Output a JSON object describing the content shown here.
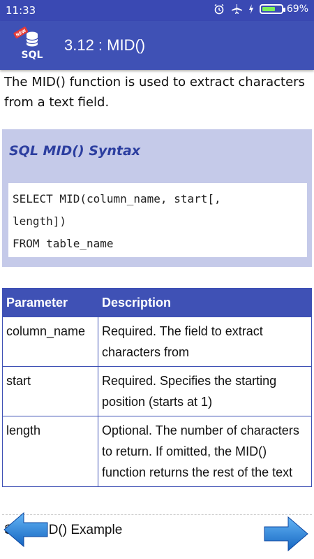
{
  "status_bar": {
    "time": "11:33",
    "battery_percent": "69%",
    "battery_level": 0.69,
    "icons": [
      "alarm-icon",
      "airplane-mode-icon",
      "charging-bolt-icon",
      "battery-icon"
    ]
  },
  "app_bar": {
    "title": "3.12 : MID()",
    "logo_text": "SQL",
    "logo_badge": "NEW"
  },
  "intro_text": "The MID() function is used to extract characters from a text field.",
  "syntax": {
    "title": "SQL MID() Syntax",
    "code_lines": [
      "SELECT MID(column_name, start[,",
      "length])",
      "FROM table_name"
    ]
  },
  "param_table": {
    "headers": [
      "Parameter",
      "Description"
    ],
    "rows": [
      {
        "param": "column_name",
        "desc": "Required. The field to extract characters from"
      },
      {
        "param": "start",
        "desc": "Required. Specifies the starting position (starts at 1)"
      },
      {
        "param": "length",
        "desc": "Optional. The number of characters to return. If omitted, the MID() function returns the rest of the text"
      }
    ]
  },
  "example_heading": "SQL MID() Example",
  "colors": {
    "status_bar": "#3a49b3",
    "app_bar": "#3f51b5",
    "syntax_bg": "#c5cae9",
    "syntax_title": "#2c3e9f",
    "nav_arrow": "#1e88e5"
  }
}
